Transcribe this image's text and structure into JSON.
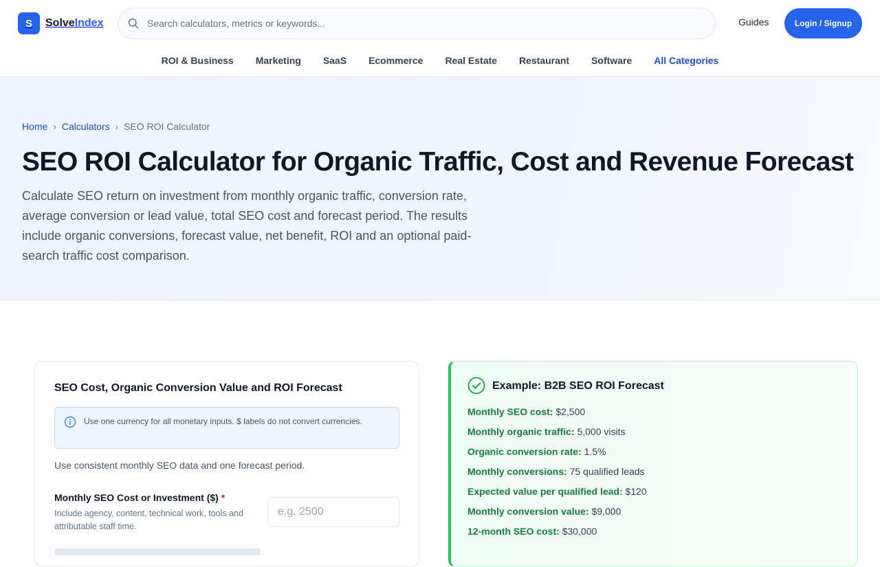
{
  "brand": {
    "mark": "S",
    "name_part1": "Solve",
    "name_part2": "Index"
  },
  "search": {
    "placeholder": "Search calculators, metrics or keywords..."
  },
  "header": {
    "guides_label": "Guides",
    "login_label": "Login / Signup"
  },
  "nav": {
    "items": [
      "ROI & Business",
      "Marketing",
      "SaaS",
      "Ecommerce",
      "Real Estate",
      "Restaurant",
      "Software"
    ],
    "all_label": "All Categories"
  },
  "breadcrumb": {
    "home": "Home",
    "calculators": "Calculators",
    "current": "SEO ROI Calculator",
    "separator": "›"
  },
  "hero": {
    "title": "SEO ROI Calculator for Organic Traffic, Cost and Revenue Forecast",
    "description": "Calculate SEO return on investment from monthly organic traffic, conversion rate, average conversion or lead value, total SEO cost and forecast period. The results include organic conversions, forecast value, net benefit, ROI and an optional paid-search traffic cost comparison."
  },
  "form": {
    "title": "SEO Cost, Organic Conversion Value and ROI Forecast",
    "currency_note": "Use one currency for all monetary inputs. $ labels do not convert currencies.",
    "consistency_note": "Use consistent monthly SEO data and one forecast period.",
    "field_cost": {
      "label": "Monthly SEO Cost or Investment ($)",
      "required_mark": "*",
      "help": "Include agency, content, technical work, tools and attributable staff time.",
      "placeholder": "e.g. 2500",
      "value": ""
    }
  },
  "example": {
    "title": "Example: B2B SEO ROI Forecast",
    "items": [
      {
        "key": "Monthly SEO cost:",
        "value": "$2,500"
      },
      {
        "key": "Monthly organic traffic:",
        "value": "5,000 visits"
      },
      {
        "key": "Organic conversion rate:",
        "value": "1.5%"
      },
      {
        "key": "Monthly conversions:",
        "value": "75 qualified leads"
      },
      {
        "key": "Expected value per qualified lead:",
        "value": "$120"
      },
      {
        "key": "Monthly conversion value:",
        "value": "$9,000"
      },
      {
        "key": "12-month SEO cost:",
        "value": "$30,000"
      }
    ]
  },
  "colors": {
    "accent": "#2563eb",
    "success": "#15803d",
    "required": "#dc2626"
  }
}
